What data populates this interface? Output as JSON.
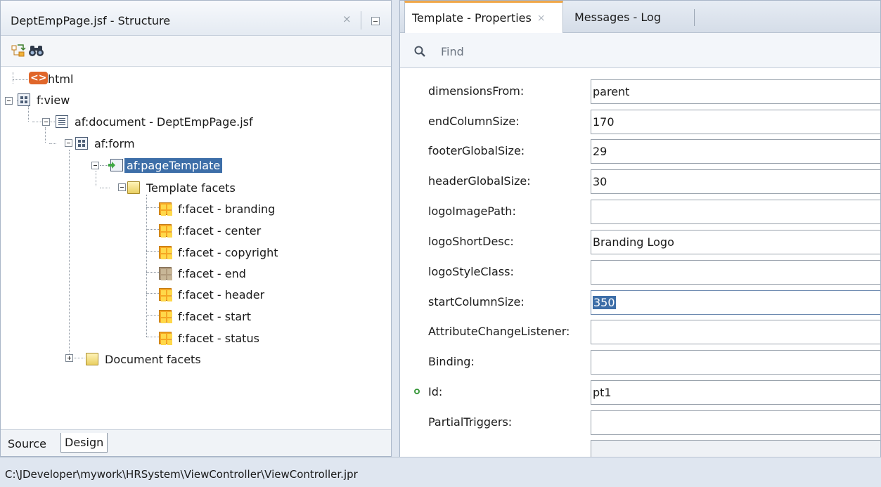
{
  "structure_panel": {
    "title": "DeptEmpPage.jsf - Structure",
    "close_icon": "×",
    "tree": {
      "html": "html",
      "view": "f:view",
      "document": "af:document - DeptEmpPage.jsf",
      "form": "af:form",
      "page_template": "af:pageTemplate",
      "template_facets": "Template facets",
      "facets": [
        "f:facet - branding",
        "f:facet - center",
        "f:facet - copyright",
        "f:facet - end",
        "f:facet - header",
        "f:facet - start",
        "f:facet - status"
      ],
      "document_facets": "Document facets"
    },
    "bottom_tabs": {
      "source": "Source",
      "design": "Design"
    }
  },
  "properties_panel": {
    "tabs": {
      "properties": "Template - Properties",
      "close_icon": "×",
      "log": "Messages - Log"
    },
    "find_placeholder": "Find",
    "properties": [
      {
        "label": "dimensionsFrom:",
        "value": "parent"
      },
      {
        "label": "endColumnSize:",
        "value": "170"
      },
      {
        "label": "footerGlobalSize:",
        "value": "29"
      },
      {
        "label": "headerGlobalSize:",
        "value": "30"
      },
      {
        "label": "logoImagePath:",
        "value": ""
      },
      {
        "label": "logoShortDesc:",
        "value": "Branding Logo"
      },
      {
        "label": "logoStyleClass:",
        "value": ""
      },
      {
        "label": "startColumnSize:",
        "value": "350"
      },
      {
        "label": "AttributeChangeListener:",
        "value": ""
      },
      {
        "label": "Binding:",
        "value": ""
      },
      {
        "label": "Id:",
        "value": "pt1"
      },
      {
        "label": "PartialTriggers:",
        "value": ""
      }
    ]
  },
  "status_bar": {
    "path": "C:\\JDeveloper\\mywork\\HRSystem\\ViewController\\ViewController.jpr"
  },
  "colors": {
    "selection": "#3d6ea8",
    "active_tab_accent": "#f0a84a",
    "required_dot": "#3d9a3f"
  }
}
